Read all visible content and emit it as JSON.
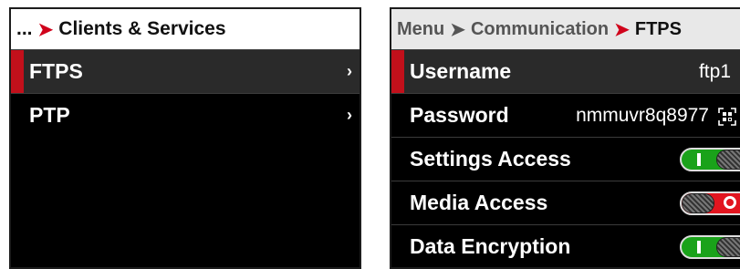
{
  "left": {
    "breadcrumb": {
      "ellipsis": "...",
      "sep": "➤",
      "current": "Clients & Services"
    },
    "items": [
      {
        "label": "FTPS",
        "chevron": "›"
      },
      {
        "label": "PTP",
        "chevron": "›"
      }
    ]
  },
  "right": {
    "breadcrumb": {
      "root": "Menu",
      "sep1": "➤",
      "middle": "Communication",
      "sep2": "➤",
      "current": "FTPS"
    },
    "rows": {
      "username": {
        "label": "Username",
        "value": "ftp1"
      },
      "password": {
        "label": "Password",
        "value": "nmmuvr8q8977",
        "icon": "qr-code-icon"
      },
      "settings_access": {
        "label": "Settings Access",
        "state": "on"
      },
      "media_access": {
        "label": "Media Access",
        "state": "off"
      },
      "data_encryption": {
        "label": "Data Encryption",
        "state": "on"
      }
    }
  },
  "colors": {
    "accent_red": "#c2101b",
    "toggle_on": "#1aa21a",
    "toggle_off": "#e2151f"
  }
}
